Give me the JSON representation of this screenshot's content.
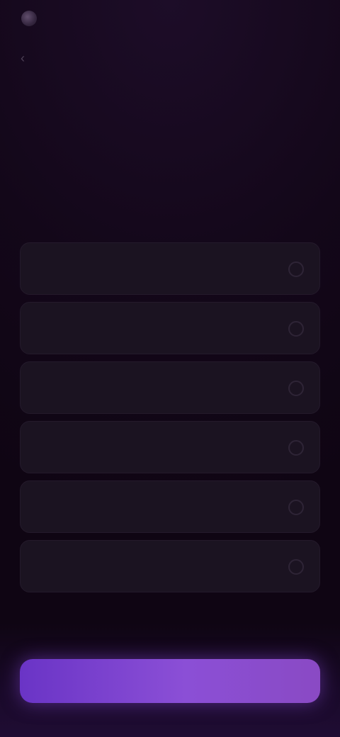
{
  "brand": {
    "logo_icon": "logo-mark-icon"
  },
  "header": {
    "title": "",
    "back_icon": "chevron-left-icon"
  },
  "headline": {
    "line1": "",
    "accent": "",
    "rest": ""
  },
  "subtitle": "",
  "options": [
    {
      "label": "",
      "icon": "radio-unselected-icon"
    },
    {
      "label": "",
      "icon": "radio-unselected-icon"
    },
    {
      "label": "",
      "icon": "radio-unselected-icon"
    },
    {
      "label": "",
      "icon": "radio-unselected-icon"
    },
    {
      "label": "",
      "icon": "radio-unselected-icon"
    },
    {
      "label": "",
      "icon": "radio-unselected-icon"
    }
  ],
  "cta": {
    "label": ""
  },
  "colors": {
    "background": "#120617",
    "accent_text": "#6f4a8c",
    "cta_start": "#6a34c6",
    "cta_end": "#8a4ac4"
  }
}
